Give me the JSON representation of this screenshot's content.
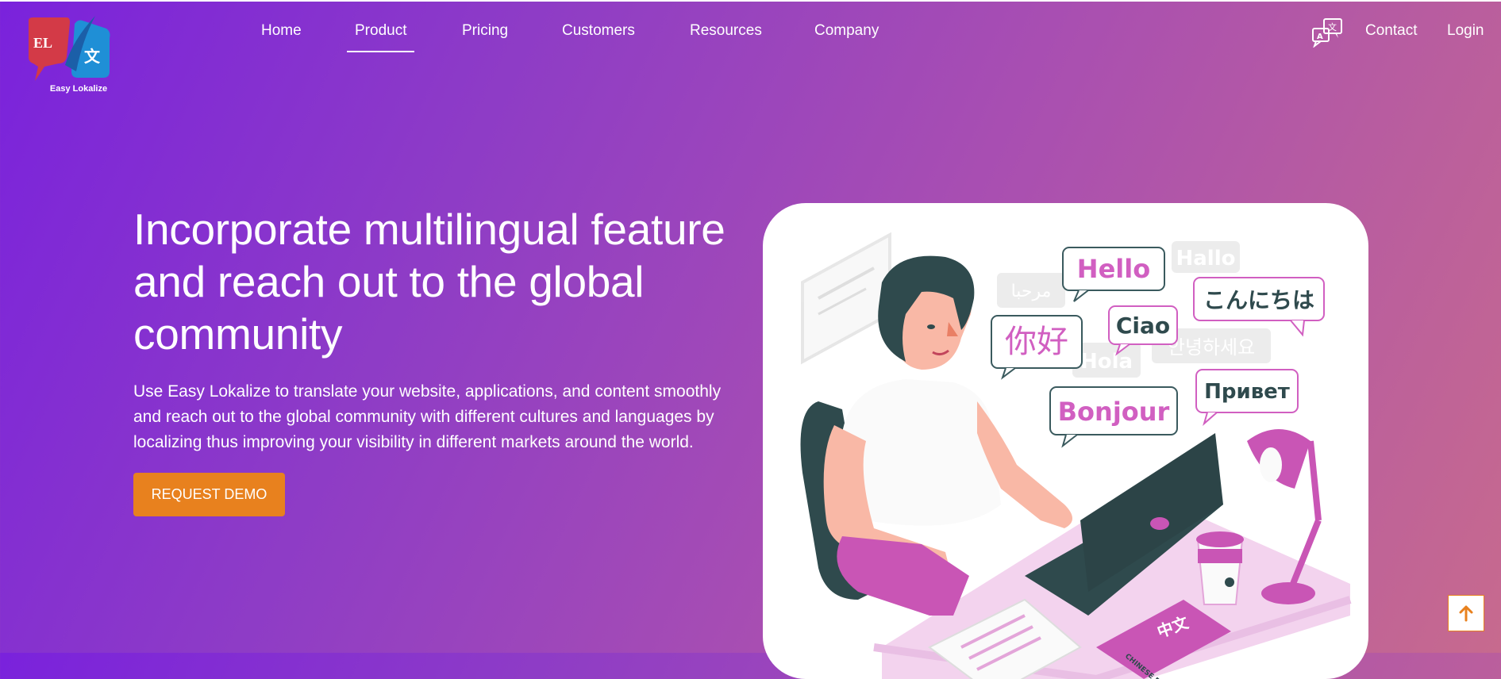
{
  "brand": {
    "name": "Easy Lokalize",
    "logo_letters": "EL",
    "logo_glyph": "文"
  },
  "nav": {
    "items": [
      {
        "label": "Home"
      },
      {
        "label": "Product",
        "active": true
      },
      {
        "label": "Pricing"
      },
      {
        "label": "Customers"
      },
      {
        "label": "Resources"
      },
      {
        "label": "Company"
      }
    ],
    "right": {
      "icon": "translate-icon",
      "contact": "Contact",
      "login": "Login"
    }
  },
  "hero": {
    "title": "Incorporate multilingual feature and reach out to the global community",
    "description": "Use Easy Lokalize to translate your website, applications, and content smoothly and reach out to the global community with different cultures and languages by localizing thus improving your visibility in different markets around the world.",
    "cta": "REQUEST DEMO"
  },
  "illustration": {
    "bubbles": {
      "hello": "Hello",
      "hallo": "Hallo",
      "arabic": "مرحبا",
      "japanese": "こんにちは",
      "ciao": "Ciao",
      "chinese": "你好",
      "korean": "안녕하세요",
      "hola": "Hola",
      "privet": "Привет",
      "bonjour": "Bonjour"
    },
    "book_title": "中文",
    "book_subtitle": "CHINESE ENGLISH"
  },
  "scroll_top": {
    "icon": "arrow-up-icon"
  },
  "colors": {
    "accent": "#e8811e",
    "gradient_start": "#7a22dc",
    "gradient_end": "#c76a8e",
    "pink": "#d15fc1"
  }
}
